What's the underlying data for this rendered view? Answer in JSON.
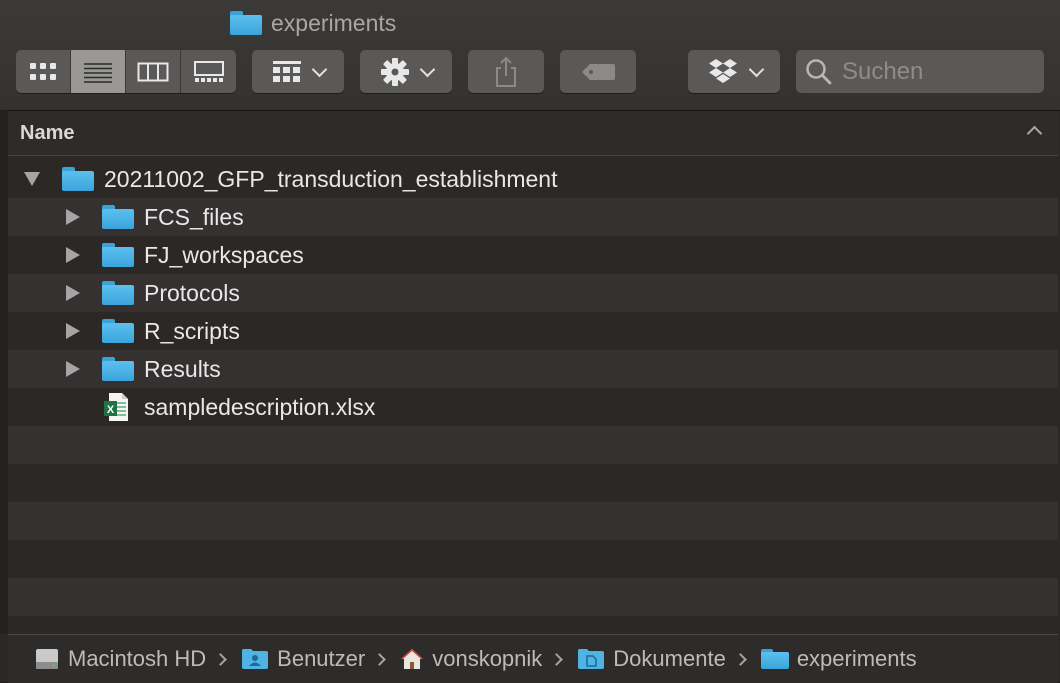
{
  "window": {
    "title": "experiments"
  },
  "toolbar": {
    "view_modes": [
      "icon-view",
      "list-view",
      "column-view",
      "gallery-view"
    ],
    "active_view": "list-view",
    "group_button_icon": "group-grid-icon",
    "action_button_icon": "gear-icon",
    "share_button_icon": "share-icon",
    "tag_button_icon": "tag-icon",
    "dropbox_button_icon": "dropbox-icon",
    "search_placeholder": "Suchen"
  },
  "list": {
    "column_header": "Name",
    "sort_direction": "ascending",
    "items": [
      {
        "name": "20211002_GFP_transduction_establishment",
        "type": "folder",
        "expanded": true,
        "level": 0
      },
      {
        "name": "FCS_files",
        "type": "folder",
        "expanded": false,
        "level": 1
      },
      {
        "name": "FJ_workspaces",
        "type": "folder",
        "expanded": false,
        "level": 1
      },
      {
        "name": "Protocols",
        "type": "folder",
        "expanded": false,
        "level": 1
      },
      {
        "name": "R_scripts",
        "type": "folder",
        "expanded": false,
        "level": 1
      },
      {
        "name": "Results",
        "type": "folder",
        "expanded": false,
        "level": 1
      },
      {
        "name": "sampledescription.xlsx",
        "type": "excel-file",
        "level": 1
      }
    ]
  },
  "pathbar": {
    "items": [
      {
        "label": "Macintosh HD",
        "icon": "hard-drive-icon"
      },
      {
        "label": "Benutzer",
        "icon": "users-folder-icon"
      },
      {
        "label": "vonskopnik",
        "icon": "home-icon"
      },
      {
        "label": "Dokumente",
        "icon": "documents-folder-icon"
      },
      {
        "label": "experiments",
        "icon": "folder-icon"
      }
    ]
  },
  "colors": {
    "folder": "#4fb3e6",
    "background": "#2b2826",
    "stripe": "#343130",
    "toolbar_button": "#5b5957",
    "excel_green": "#1f7244"
  }
}
